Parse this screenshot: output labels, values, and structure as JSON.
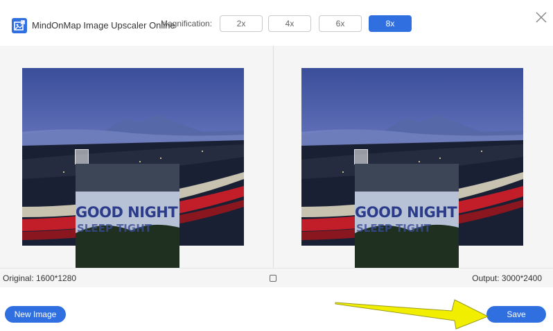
{
  "header": {
    "app_title": "MindOnMap Image Upscaler Online",
    "magnification_label": "Magnification:",
    "magnification_options": [
      "2x",
      "4x",
      "6x",
      "8x"
    ],
    "selected_magnification": "8x"
  },
  "preview": {
    "zoom_caption_line1": "GOOD NIGHT",
    "zoom_caption_line2": "SLEEP TIGHT"
  },
  "info": {
    "original_label": "Original: 1600*1280",
    "output_label": "Output: 3000*2400"
  },
  "footer": {
    "new_image_label": "New Image",
    "save_label": "Save"
  },
  "colors": {
    "accent": "#2f6fe0",
    "annotation_arrow": "#f2ee00"
  },
  "icons": [
    "app-logo-icon",
    "close-icon",
    "compare-icon",
    "yellow-arrow-annotation"
  ]
}
